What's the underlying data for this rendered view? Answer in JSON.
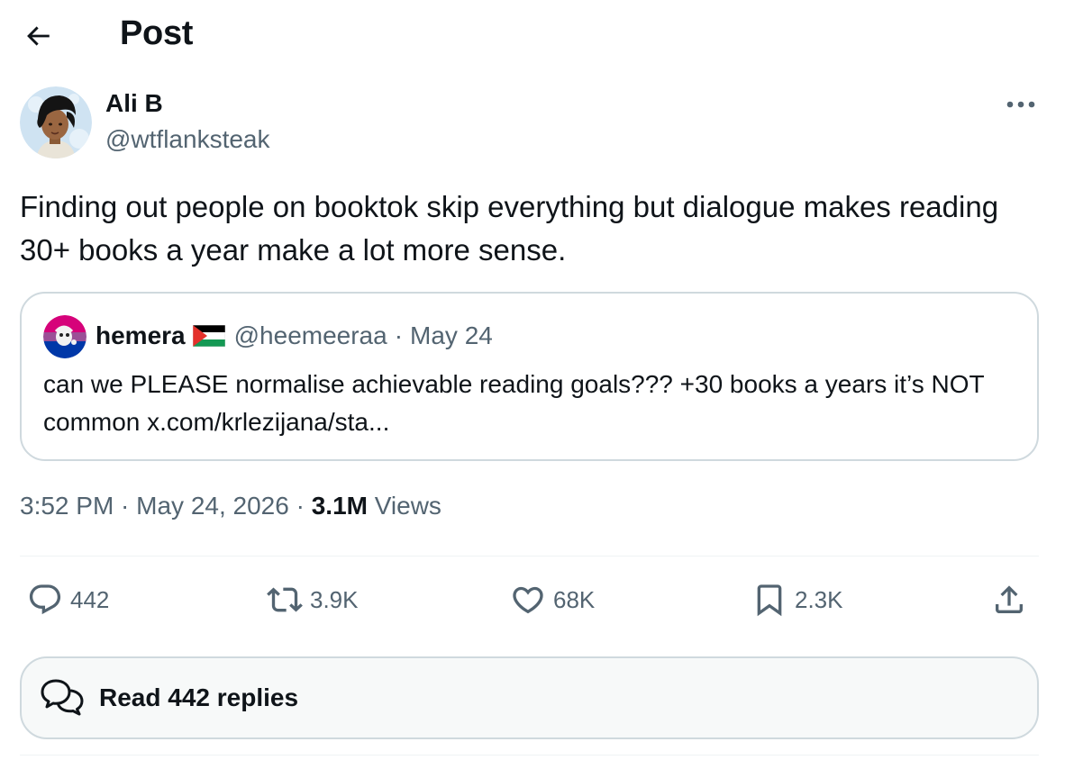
{
  "header": {
    "title": "Post",
    "back_icon": "arrow-left-icon"
  },
  "post": {
    "author": {
      "name": "Ali B",
      "handle": "@wtflanksteak"
    },
    "text": "Finding out people on booktok skip everything but dialogue makes reading 30+ books a year make a lot more sense.",
    "quote": {
      "name": "hemera",
      "flag_icon": "palestine-flag-icon",
      "handle": "@heemeeraa",
      "separator": "·",
      "date": "May 24",
      "text": "can we PLEASE normalise achievable reading goals??? +30 books a years it’s NOT common x.com/krlezijana/sta..."
    },
    "timestamp": "3:52 PM · May 24, 2026 · ",
    "views_count": "3.1M",
    "views_label": " Views"
  },
  "actions": {
    "replies": "442",
    "reposts": "3.9K",
    "likes": "68K",
    "bookmarks": "2.3K"
  },
  "read_replies": {
    "label": "Read 442 replies"
  },
  "colors": {
    "text_primary": "#0f1419",
    "text_secondary": "#536471",
    "border": "#cfd9de",
    "divider": "#eff3f4",
    "button_bg": "#f7f9f9"
  }
}
